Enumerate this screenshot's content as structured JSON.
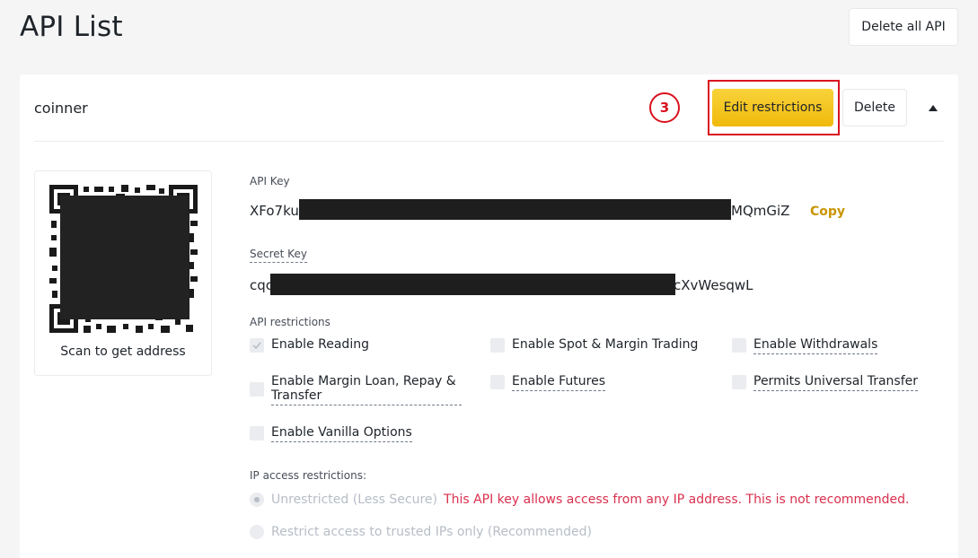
{
  "page": {
    "title": "API List"
  },
  "toolbar": {
    "delete_all_label": "Delete all API"
  },
  "api_card": {
    "name": "coinner",
    "step_number": "3",
    "edit_label": "Edit restrictions",
    "delete_label": "Delete",
    "qr_caption": "Scan to get address",
    "api_key_label": "API Key",
    "api_key_prefix": "XFo7ku",
    "api_key_suffix": "MQmGiZ",
    "copy_label": "Copy",
    "secret_key_label": "Secret Key",
    "secret_key_prefix": "cqc",
    "secret_key_suffix": "cXvWesqwL",
    "restrictions_label": "API restrictions",
    "restrictions": [
      {
        "label": "Enable Reading",
        "checked": true
      },
      {
        "label": "Enable Spot & Margin Trading",
        "checked": false
      },
      {
        "label": "Enable Withdrawals",
        "checked": false
      },
      {
        "label": "Enable Margin Loan, Repay & Transfer",
        "checked": false
      },
      {
        "label": "Enable Futures",
        "checked": false
      },
      {
        "label": "Permits Universal Transfer",
        "checked": false
      },
      {
        "label": "Enable Vanilla Options",
        "checked": false
      }
    ],
    "ip_label": "IP access restrictions:",
    "ip_options": [
      {
        "label": "Unrestricted (Less Secure)",
        "selected": true,
        "warning": "This API key allows access from any IP address. This is not recommended."
      },
      {
        "label": "Restrict access to trusted IPs only (Recommended)",
        "selected": false
      }
    ]
  },
  "colors": {
    "accent": "#f0b90b",
    "warning": "#d9304e",
    "highlight": "#d9121f",
    "link": "#c99400"
  }
}
